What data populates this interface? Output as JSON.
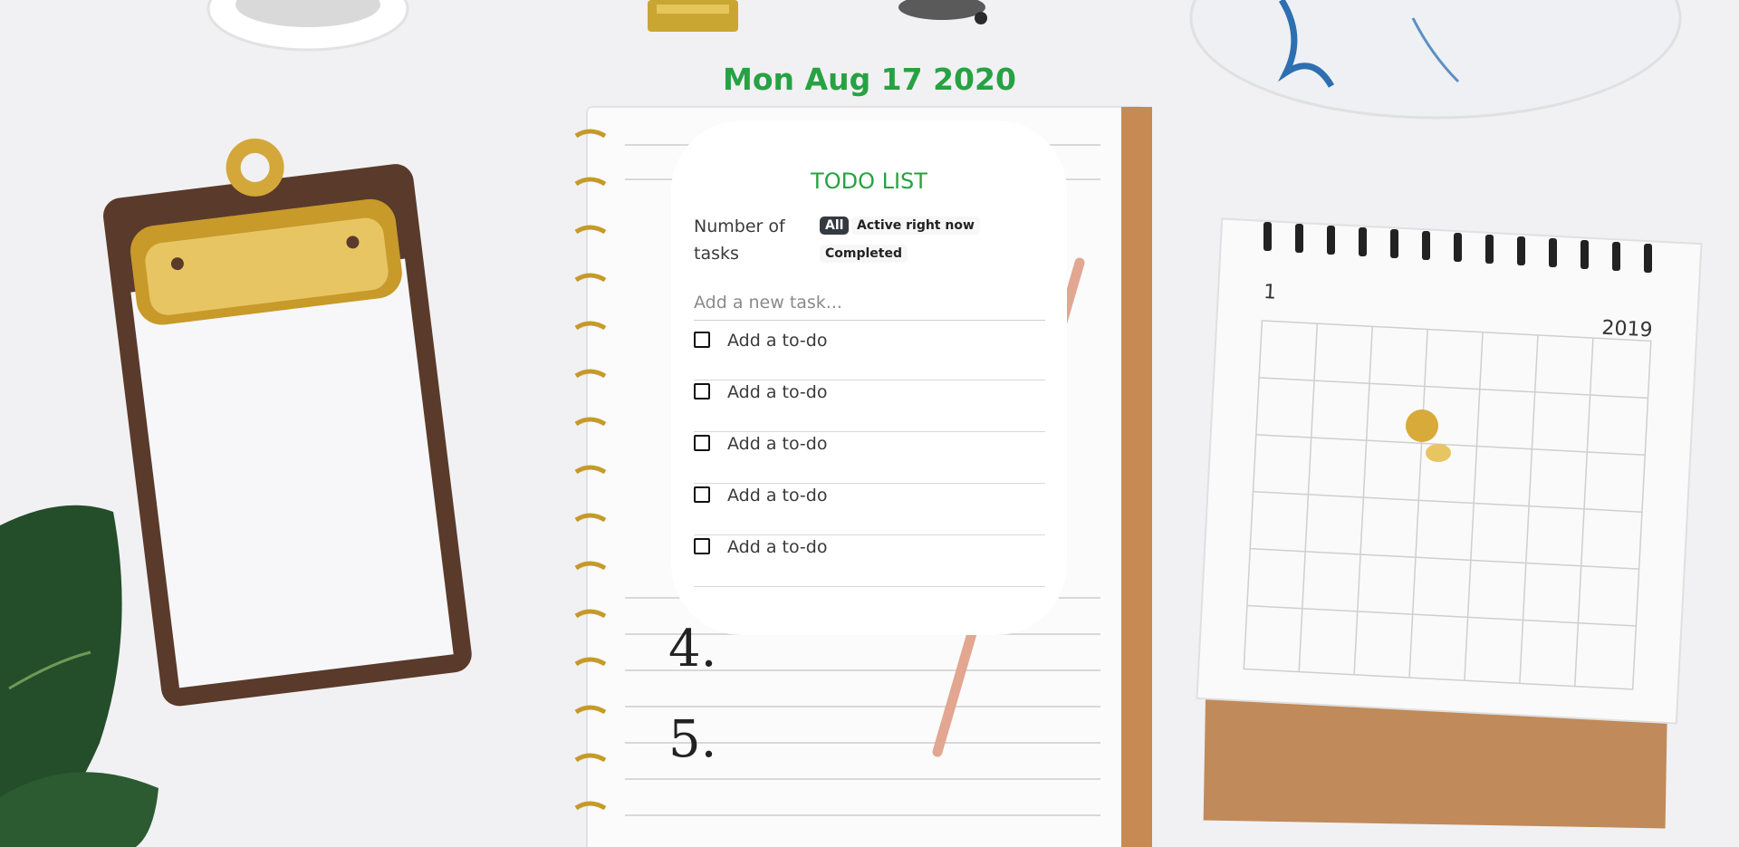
{
  "date": "Mon Aug 17 2020",
  "todo": {
    "title": "TODO LIST",
    "count_label": "Number of tasks",
    "filters": {
      "all": "All",
      "active": "Active right now",
      "completed": "Completed"
    },
    "new_task_placeholder": "Add a new task...",
    "items": [
      {
        "label": "Add a to-do",
        "checked": false
      },
      {
        "label": "Add a to-do",
        "checked": false
      },
      {
        "label": "Add a to-do",
        "checked": false
      },
      {
        "label": "Add a to-do",
        "checked": false
      },
      {
        "label": "Add a to-do",
        "checked": false
      }
    ]
  },
  "colors": {
    "accent_green": "#27a243",
    "active_filter_bg": "#343a40",
    "card_bg": "#ffffff"
  }
}
